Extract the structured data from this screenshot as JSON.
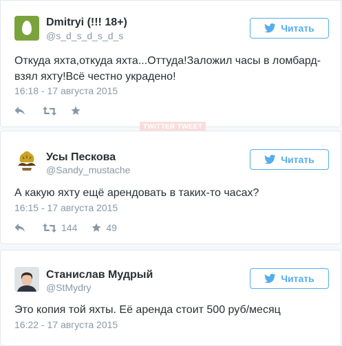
{
  "tweets": [
    {
      "name": "Dmitryi (!!! 18+)",
      "handle": "@s_d_s_d_s_d_s",
      "follow_label": "Читать",
      "text": "Откуда яхта,откуда яхта...Оттуда!Заложил часы в ломбард-взял яхту!Всё честно украдено!",
      "time": "16:18 - 17 августа 2015",
      "avatar": "egg-avatar"
    },
    {
      "name": "Усы Пескова",
      "handle": "@Sandy_mustache",
      "follow_label": "Читать",
      "text": "А какую яхту ещё арендовать в таких-то часах?",
      "time": "16:15 - 17 августа 2015",
      "retweets": "144",
      "favorites": "49",
      "avatar": "mustache-avatar"
    },
    {
      "name": "Станислав Мудрый",
      "handle": "@StMydry",
      "follow_label": "Читать",
      "text": "Это копия той яхты. Её аренда стоит 500 руб/месяц",
      "time": "16:22 - 17 августа 2015",
      "avatar": "person-avatar"
    }
  ],
  "watermark": "TWITTER TWEET",
  "colors": {
    "accent": "#55acee",
    "muted": "#8899a6",
    "text": "#292f33",
    "egg_bg": "#7ba33d",
    "marker": "#e0245e"
  }
}
